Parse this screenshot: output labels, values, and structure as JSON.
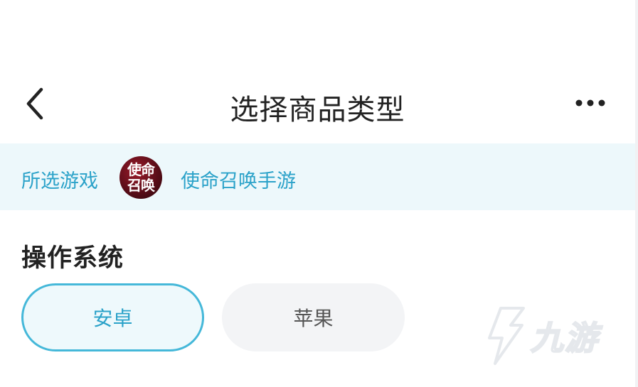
{
  "header": {
    "title": "选择商品类型",
    "back_icon": "chevron-left-icon",
    "more_icon": "more-horizontal-icon"
  },
  "game": {
    "label": "所选游戏",
    "logo_text": "使命召唤",
    "name": "使命召唤手游"
  },
  "os_section": {
    "title": "操作系统",
    "options": [
      {
        "label": "安卓",
        "selected": true
      },
      {
        "label": "苹果",
        "selected": false
      }
    ]
  },
  "watermark": {
    "text": "九游"
  },
  "colors": {
    "accent": "#2ba2c9",
    "banner_bg": "#edf8fb",
    "selected_border": "#45b8d9",
    "option_bg": "#f3f4f6",
    "text_dark": "#222222"
  }
}
